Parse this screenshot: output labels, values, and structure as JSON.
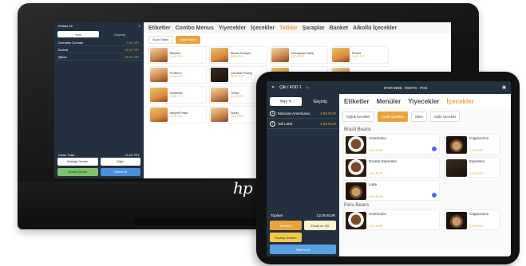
{
  "monitor": {
    "brand_mark": "hp",
    "sidebar": {
      "top_label": "Masa 18",
      "tabs": [
        {
          "label": "Yeni"
        },
        {
          "label": "Geçmiş"
        }
      ],
      "orders": [
        {
          "name": "Domates Çorbası",
          "price": "7,00 TRY"
        },
        {
          "name": "Brokoli",
          "price": "24,00 TRY"
        },
        {
          "name": "Şiklaz",
          "price": "18,00 TRY"
        }
      ],
      "total_label": "Kalan Tutar",
      "total_value": "74,00 TRY",
      "buttons": [
        {
          "label": "Mutfağa Gönder"
        },
        {
          "label": "Diğer"
        },
        {
          "label": "Siparişi Gönder"
        },
        {
          "label": "Ödeme Al"
        }
      ]
    },
    "categories": [
      {
        "label": "Etiketler"
      },
      {
        "label": "Combo Menus"
      },
      {
        "label": "Yiyecekler"
      },
      {
        "label": "İçecekler"
      },
      {
        "label": "Tatlılar"
      },
      {
        "label": "Şaraplar"
      },
      {
        "label": "Banket"
      },
      {
        "label": "Alkollü İçecekler"
      }
    ],
    "subcategories": [
      {
        "label": "Sıcak Tatlılar"
      },
      {
        "label": "Soğuk Tatlılar"
      }
    ],
    "products": [
      {
        "name": "Baklava",
        "price": "24,00 TRY"
      },
      {
        "name": "Ekmek Kadayıfı",
        "price": "28,00 TRY"
      },
      {
        "name": "Kemalpaşa Tatlısı",
        "price": "22,00 TRY"
      },
      {
        "name": "Revani",
        "price": "18,00 TRY"
      },
      {
        "name": "Profiterol",
        "price": "26,00 TRY"
      },
      {
        "name": "Çikolatalı Puding",
        "price": "16,00 TRY"
      },
      {
        "name": "",
        "price": ""
      },
      {
        "name": "",
        "price": ""
      },
      {
        "name": "Kazandibi",
        "price": "20,00 TRY"
      },
      {
        "name": "Trileçe",
        "price": "22,00 TRY"
      },
      {
        "name": "",
        "price": ""
      },
      {
        "name": "",
        "price": ""
      },
      {
        "name": "Meyveli Pasta",
        "price": "24,00 TRY"
      },
      {
        "name": "Sütlaç",
        "price": "18,00 TRY"
      }
    ]
  },
  "tablet": {
    "header": {
      "table_label": "Çiki / KOD 1",
      "brand_text": "STAR WEB · RESTO · POS"
    },
    "sidebar": {
      "tabs": [
        {
          "label": "Yeni"
        },
        {
          "label": "Geçmiş"
        }
      ],
      "orders": [
        {
          "qty": "1",
          "name": "Mexican Americano",
          "price": "4,50 EUR"
        },
        {
          "qty": "1",
          "name": "Tall Latte",
          "price": "4,50 EUR"
        }
      ],
      "total_label": "Toplam",
      "total_value": "12,00 EUR",
      "buttons": [
        {
          "label": "Bölüm'a",
          "style": "amber"
        },
        {
          "label": "Fırsat ve QR",
          "style": "cream"
        },
        {
          "label": "Siparişi Gönder",
          "style": "yellow"
        },
        {
          "label": "Ödeme Al",
          "style": "blue"
        }
      ]
    },
    "categories": [
      {
        "label": "Etiketler"
      },
      {
        "label": "Menüler"
      },
      {
        "label": "Yiyecekler"
      },
      {
        "label": "İçecekler"
      }
    ],
    "subcategories": [
      {
        "label": "Soğuk İçecekler"
      },
      {
        "label": "Sıcak İçecekler"
      },
      {
        "label": "Birler"
      },
      {
        "label": "Sütlü İçecekler"
      }
    ],
    "sections": [
      {
        "title": "Brasil Beans",
        "products": [
          {
            "name": "Americano",
            "price": "4,50 EUR"
          },
          {
            "name": "Cappuccino",
            "price": "4,50 EUR"
          },
          {
            "name": "Double Espresso",
            "price": "4,50 EUR"
          },
          {
            "name": "Espresso",
            "price": "4,50 EUR"
          },
          {
            "name": "Latte",
            "price": "4,50 EUR"
          }
        ]
      },
      {
        "title": "Peru Beans",
        "products": [
          {
            "name": "Americano",
            "price": "4,50 EUR"
          },
          {
            "name": "Cappuccino",
            "price": "4,50 EUR"
          }
        ]
      }
    ]
  }
}
